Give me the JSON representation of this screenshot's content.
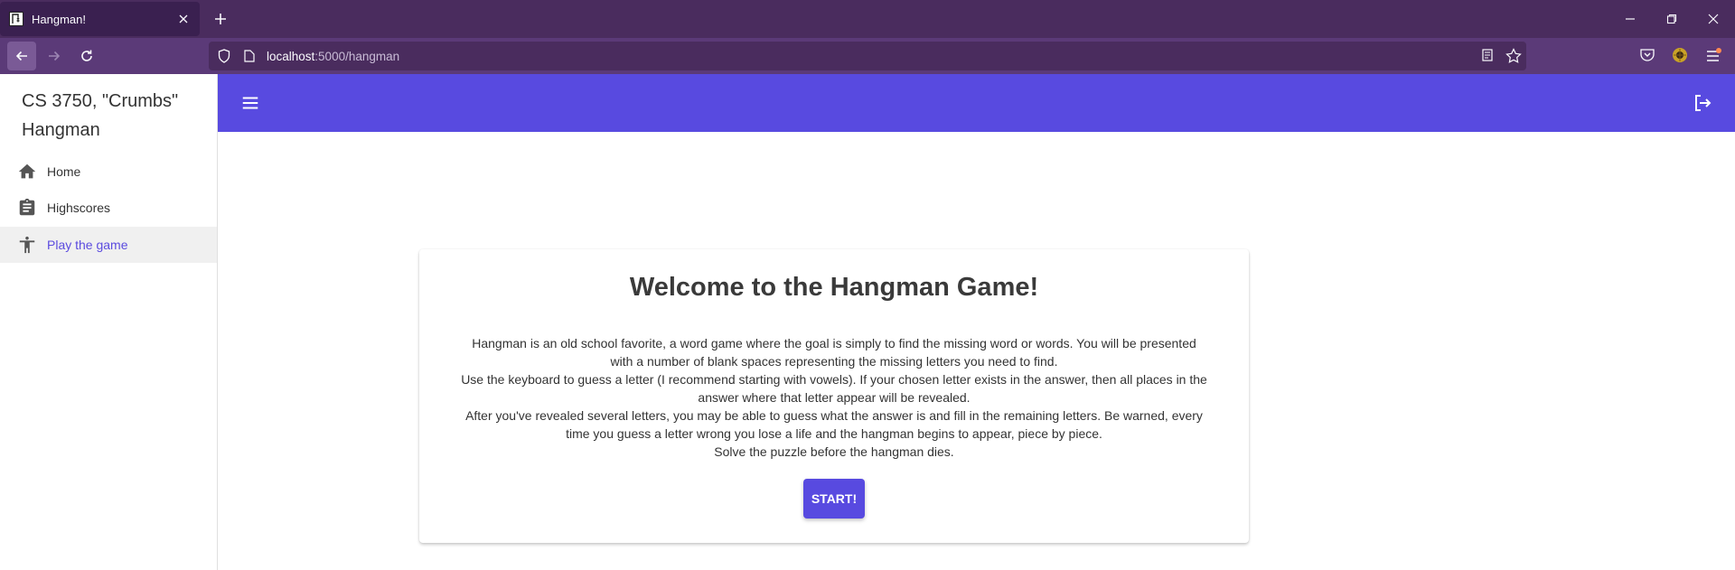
{
  "browser": {
    "tab_title": "Hangman!",
    "url_host": "localhost",
    "url_path": ":5000/hangman"
  },
  "sidebar": {
    "brand": "CS 3750, \"Crumbs\" Hangman",
    "items": [
      {
        "label": "Home",
        "icon": "home-icon"
      },
      {
        "label": "Highscores",
        "icon": "clipboard-icon"
      },
      {
        "label": "Play the game",
        "icon": "accessibility-icon",
        "active": true
      }
    ]
  },
  "main": {
    "title": "Welcome to the Hangman Game!",
    "paragraphs": [
      "Hangman is an old school favorite, a word game where the goal is simply to find the missing word or words. You will be presented with a number of blank spaces representing the missing letters you need to find.",
      "Use the keyboard to guess a letter (I recommend starting with vowels). If your chosen letter exists in the answer, then all places in the answer where that letter appear will be revealed.",
      "After you've revealed several letters, you may be able to guess what the answer is and fill in the remaining letters. Be warned, every time you guess a letter wrong you lose a life and the hangman begins to appear, piece by piece.",
      "Solve the puzzle before the hangman dies."
    ],
    "start_label": "START!"
  },
  "colors": {
    "accent": "#584ae0",
    "browser_frame": "#4a2c5e",
    "browser_toolbar": "#5b3a78"
  }
}
